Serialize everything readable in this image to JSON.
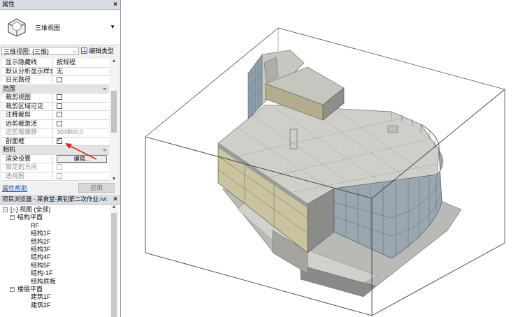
{
  "properties": {
    "title": "属性",
    "close": "×",
    "type_name": "三维视图",
    "view_selector": "三维视图: {三维}",
    "edit_type": "编辑类型",
    "rows": [
      {
        "kind": "prop",
        "label": "显示隐藏线",
        "value": "按规程"
      },
      {
        "kind": "prop",
        "label": "默认分析显示样式",
        "value": "无"
      },
      {
        "kind": "prop",
        "label": "日光路径",
        "check": false
      },
      {
        "kind": "cat",
        "label": "范围",
        "chev": "≈"
      },
      {
        "kind": "prop",
        "label": "裁剪视图",
        "check": false
      },
      {
        "kind": "prop",
        "label": "裁剪区域可见",
        "check": false
      },
      {
        "kind": "prop",
        "label": "注释裁剪",
        "check": false
      },
      {
        "kind": "prop",
        "label": "远剪裁激活",
        "check": false
      },
      {
        "kind": "prop",
        "label": "远剪裁偏移",
        "value": "304800.0",
        "disabled": true
      },
      {
        "kind": "prop",
        "label": "剖面框",
        "check": true
      },
      {
        "kind": "cat",
        "label": "相机",
        "chev": "≈"
      },
      {
        "kind": "prop",
        "label": "渲染设置",
        "button": "编辑..."
      },
      {
        "kind": "prop",
        "label": "锁定的方向",
        "check": false,
        "disabled": true
      },
      {
        "kind": "prop",
        "label": "透视图",
        "check": false,
        "disabled": true
      }
    ],
    "help_link": "属性帮助",
    "apply": "应用"
  },
  "browser": {
    "title": "项目浏览器 - 某食堂-黄钊第二次作业.rvt",
    "close": "×",
    "nodes": [
      {
        "label": "[○] 视图 (全部)",
        "level": 0,
        "toggle": "−"
      },
      {
        "label": "结构平面",
        "level": 1,
        "toggle": "−"
      },
      {
        "label": "RF",
        "level": 2
      },
      {
        "label": "结构1F",
        "level": 2
      },
      {
        "label": "结构2F",
        "level": 2
      },
      {
        "label": "结构3F",
        "level": 2
      },
      {
        "label": "结构4F",
        "level": 2
      },
      {
        "label": "结构5F",
        "level": 2
      },
      {
        "label": "结构-1F",
        "level": 2
      },
      {
        "label": "结构底板",
        "level": 2
      },
      {
        "label": "楼层平面",
        "level": 1,
        "toggle": "−"
      },
      {
        "label": "建筑1F",
        "level": 2
      },
      {
        "label": "建筑2F",
        "level": 2
      }
    ]
  },
  "icons": {
    "type_icon": "3d-view-house-icon",
    "edit_type_icon": "edit-type-icon",
    "annotation_arrow_color": "#e0271b"
  },
  "colors": {
    "panel_bg": "#f0f0f0",
    "title_bg": "#d9dee6",
    "link": "#1155cc",
    "model_light": "#d3d3cf",
    "model_mid": "#a9a9a6",
    "model_dark": "#7c7c7a",
    "wall_tan": "#c9c3a0",
    "glass": "#8fa0ad"
  }
}
